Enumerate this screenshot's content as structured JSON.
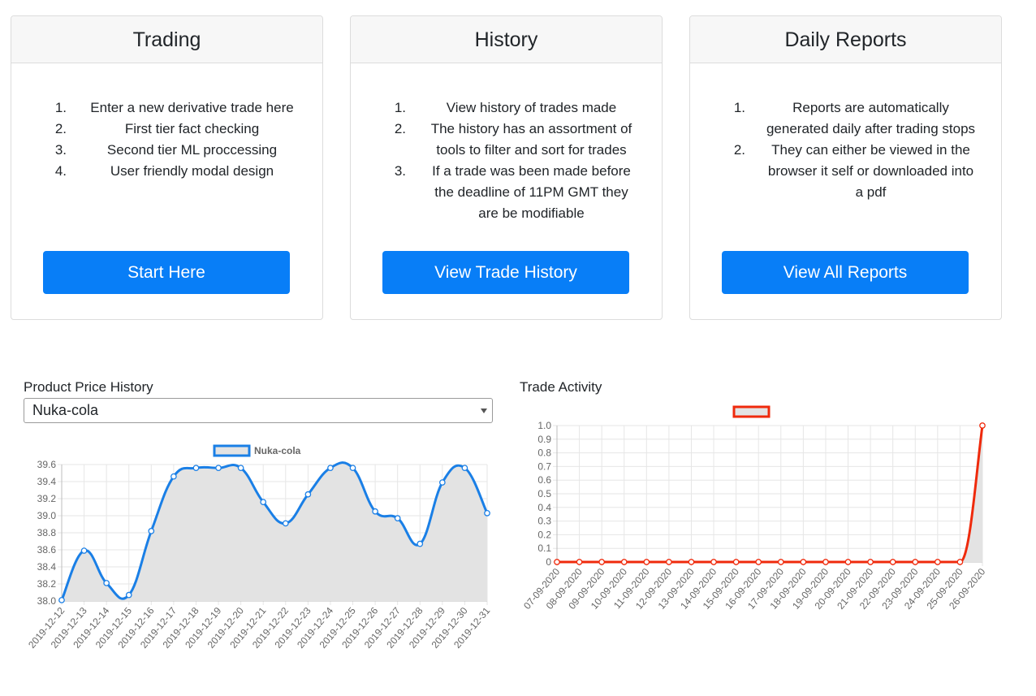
{
  "cards": [
    {
      "title": "Trading",
      "items": [
        {
          "num": "1.",
          "text": "Enter a new derivative trade here"
        },
        {
          "num": "2.",
          "text": "First tier fact checking"
        },
        {
          "num": "3.",
          "text": "Second tier ML proccessing"
        },
        {
          "num": "4.",
          "text": "User friendly modal design"
        }
      ],
      "button": "Start Here"
    },
    {
      "title": "History",
      "items": [
        {
          "num": "1.",
          "text": "View history of trades made"
        },
        {
          "num": "2.",
          "text": "The history has an assortment of tools to filter and sort for trades"
        },
        {
          "num": "3.",
          "text": "If a trade was been made before the deadline of 11PM GMT they are be modifiable"
        }
      ],
      "button": "View Trade History"
    },
    {
      "title": "Daily Reports",
      "items": [
        {
          "num": "1.",
          "text": "Reports are automatically generated daily after trading stops"
        },
        {
          "num": "2.",
          "text": "They can either be viewed in the browser it self or downloaded into a pdf"
        }
      ],
      "button": "View All Reports"
    }
  ],
  "price_history": {
    "label": "Product Price History",
    "selected_product": "Nuka-cola"
  },
  "trade_activity": {
    "label": "Trade Activity"
  },
  "colors": {
    "primary": "#087ef7",
    "price_line": "#1a7fe6",
    "activity_line": "#ef2a0c",
    "fill": "#e3e3e3",
    "grid": "#e6e6e6"
  },
  "chart_data": [
    {
      "type": "line",
      "title": "",
      "xlabel": "",
      "ylabel": "",
      "legend": "top-center",
      "grid": true,
      "ylim": [
        38.0,
        39.6
      ],
      "yticks": [
        "39.6",
        "39.4",
        "39.2",
        "39.0",
        "38.8",
        "38.6",
        "38.4",
        "38.2",
        "38.0"
      ],
      "categories": [
        "2019-12-12",
        "2019-12-13",
        "2019-12-14",
        "2019-12-15",
        "2019-12-16",
        "2019-12-17",
        "2019-12-18",
        "2019-12-19",
        "2019-12-20",
        "2019-12-21",
        "2019-12-22",
        "2019-12-23",
        "2019-12-24",
        "2019-12-25",
        "2019-12-26",
        "2019-12-27",
        "2019-12-28",
        "2019-12-29",
        "2019-12-30",
        "2019-12-31"
      ],
      "series": [
        {
          "name": "Nuka-cola",
          "values": [
            38.01,
            38.59,
            38.21,
            38.07,
            38.82,
            39.46,
            39.56,
            39.56,
            39.56,
            39.16,
            38.91,
            39.25,
            39.56,
            39.56,
            39.05,
            38.97,
            38.67,
            39.39,
            39.56,
            39.03
          ]
        }
      ]
    },
    {
      "type": "line",
      "title": "",
      "xlabel": "",
      "ylabel": "",
      "legend": "top-center",
      "grid": true,
      "ylim": [
        0,
        1
      ],
      "yticks": [
        "1.0",
        "0.9",
        "0.8",
        "0.7",
        "0.6",
        "0.5",
        "0.4",
        "0.3",
        "0.2",
        "0.1",
        "0"
      ],
      "categories": [
        "07-09-2020",
        "08-09-2020",
        "09-09-2020",
        "10-09-2020",
        "11-09-2020",
        "12-09-2020",
        "13-09-2020",
        "14-09-2020",
        "15-09-2020",
        "16-09-2020",
        "17-09-2020",
        "18-09-2020",
        "19-09-2020",
        "20-09-2020",
        "21-09-2020",
        "22-09-2020",
        "23-09-2020",
        "24-09-2020",
        "25-09-2020",
        "26-09-2020"
      ],
      "series": [
        {
          "values": [
            0,
            0,
            0,
            0,
            0,
            0,
            0,
            0,
            0,
            0,
            0,
            0,
            0,
            0,
            0,
            0,
            0,
            0,
            0,
            1
          ]
        }
      ]
    }
  ]
}
